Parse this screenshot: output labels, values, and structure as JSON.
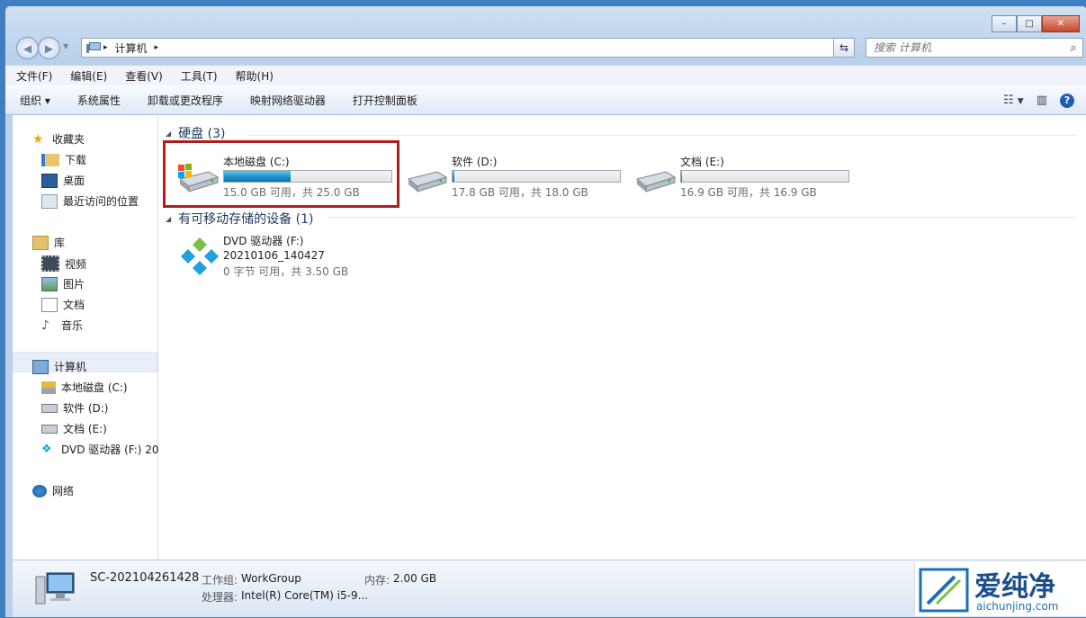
{
  "window": {
    "minimize": "–",
    "maximize": "□",
    "close": "✕"
  },
  "address": {
    "root_label": "计算机",
    "sep": "▸"
  },
  "search": {
    "placeholder": "搜索 计算机"
  },
  "menu": [
    "文件(F)",
    "编辑(E)",
    "查看(V)",
    "工具(T)",
    "帮助(H)"
  ],
  "toolbar": {
    "organize": "组织 ▾",
    "items": [
      "系统属性",
      "卸载或更改程序",
      "映射网络驱动器",
      "打开控制面板"
    ],
    "help": "?"
  },
  "sidebar": {
    "favorites": {
      "header": "收藏夹",
      "items": [
        "下载",
        "桌面",
        "最近访问的位置"
      ]
    },
    "libraries": {
      "header": "库",
      "items": [
        "视频",
        "图片",
        "文档",
        "音乐"
      ]
    },
    "computer": {
      "header": "计算机",
      "items": [
        "本地磁盘 (C:)",
        "软件 (D:)",
        "文档 (E:)",
        "DVD 驱动器 (F:) 20"
      ]
    },
    "network": {
      "header": "网络"
    }
  },
  "groups": {
    "hdd": "硬盘 (3)",
    "removable": "有可移动存储的设备 (1)"
  },
  "drives": [
    {
      "name": "本地磁盘 (C:)",
      "free": "15.0 GB 可用，共 25.0 GB",
      "used_fraction": 0.4
    },
    {
      "name": "软件 (D:)",
      "free": "17.8 GB 可用，共 18.0 GB",
      "used_fraction": 0.011
    },
    {
      "name": "文档 (E:)",
      "free": "16.9 GB 可用，共 16.9 GB",
      "used_fraction": 0.005
    }
  ],
  "dvd": {
    "name": "DVD 驱动器 (F:)",
    "label": "20210106_140427",
    "free": "0 字节 可用，共 3.50 GB"
  },
  "details": {
    "computer_name": "SC-202104261428",
    "workgroup_label": "工作组:",
    "workgroup": "WorkGroup",
    "memory_label": "内存:",
    "memory": "2.00 GB",
    "processor_label": "处理器:",
    "processor": "Intel(R) Core(TM) i5-9..."
  },
  "watermark": {
    "text": "爱纯净",
    "url": "aichunjing.com"
  }
}
